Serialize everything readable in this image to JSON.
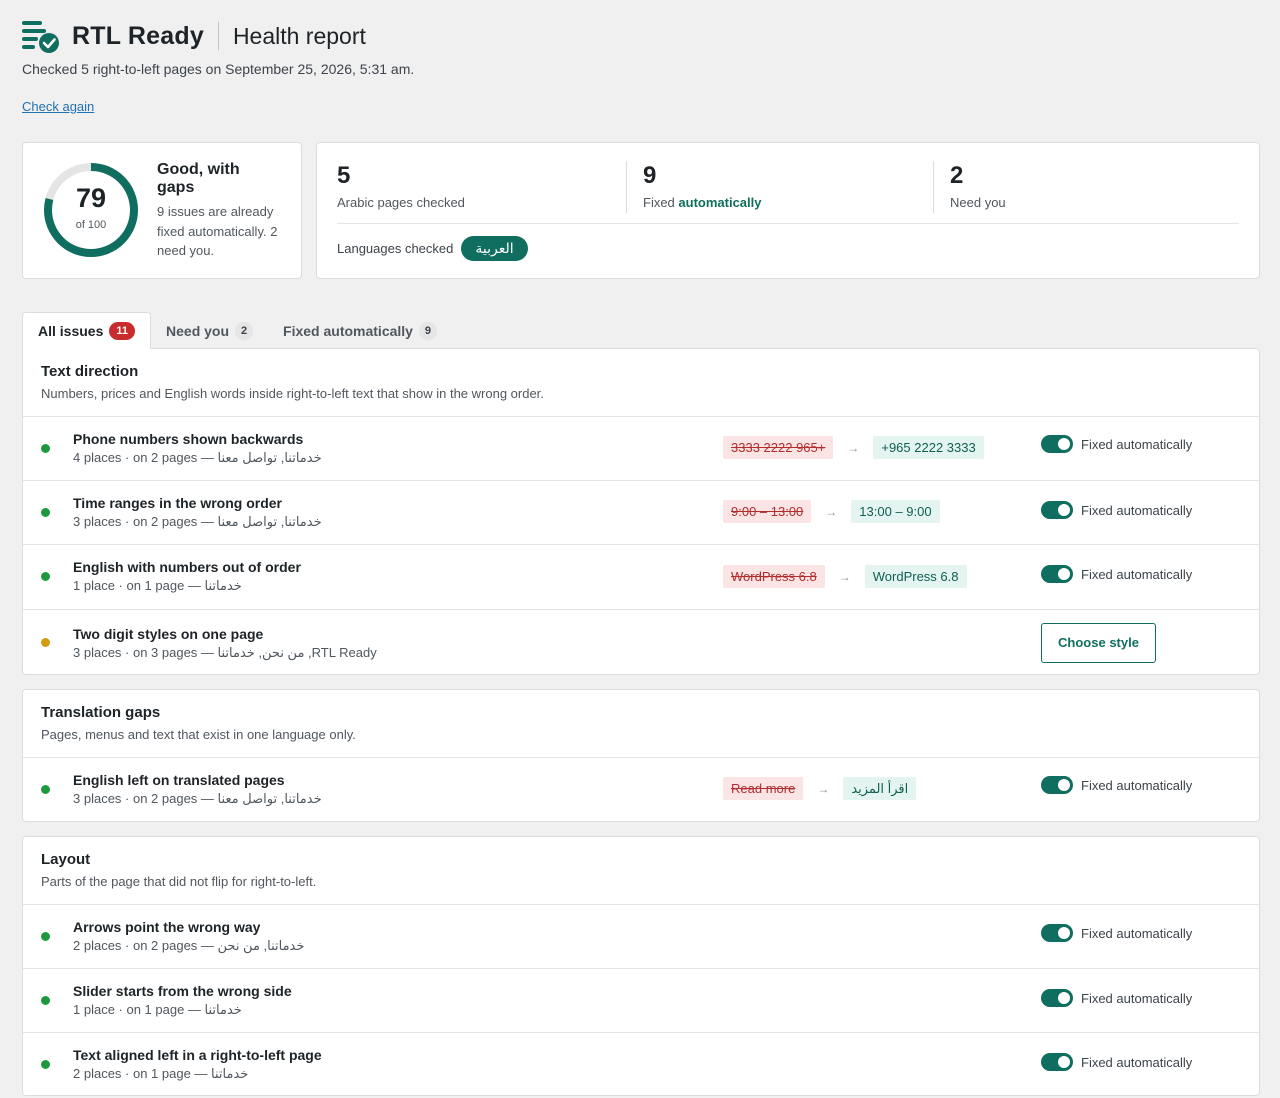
{
  "header": {
    "brand": "RTL Ready",
    "title": "Health report",
    "subtitle": "Checked 5 right-to-left pages on September 25, 2026, 5:31 am.",
    "check_again": "Check again"
  },
  "score": {
    "value": "79",
    "of": "of 100",
    "fraction": 0.79,
    "title": "Good, with gaps",
    "description": "9 issues are already fixed automatically. 2 need you."
  },
  "stats": {
    "pages": {
      "value": "5",
      "label": "Arabic pages checked"
    },
    "fixed": {
      "value": "9",
      "label_prefix": "Fixed ",
      "label_accent": "automatically"
    },
    "need": {
      "value": "2",
      "label": "Need you"
    },
    "languages_label": "Languages checked",
    "language": "العربية"
  },
  "tabs": [
    {
      "label": "All issues",
      "count": "11"
    },
    {
      "label": "Need you",
      "count": "2"
    },
    {
      "label": "Fixed automatically",
      "count": "9"
    }
  ],
  "sections": [
    {
      "title": "Text direction",
      "description": "Numbers, prices and English words inside right-to-left text that show in the wrong order.",
      "rows": [
        {
          "title": "Phone numbers shown backwards",
          "meta_prefix": "4 places · on 2 pages — ",
          "meta_pages": "خدماتنا, تواصل معنا",
          "before": "3333 2222 965+",
          "after": "+965 2222 3333",
          "status": "Fixed automatically"
        },
        {
          "title": "Time ranges in the wrong order",
          "meta_prefix": "3 places · on 2 pages — ",
          "meta_pages": "خدماتنا, تواصل معنا",
          "before": "9:00 – 13:00",
          "after": "13:00 – 9:00",
          "status": "Fixed automatically"
        },
        {
          "title": "English with numbers out of order",
          "meta_prefix": "1 place · on 1 page — ",
          "meta_pages": "خدماتنا",
          "before": "WordPress 6.8",
          "after": "WordPress 6.8",
          "status": "Fixed automatically"
        },
        {
          "title": "Two digit styles on one page",
          "meta_prefix": "3 places · on 3 pages — ",
          "meta_pages": "RTL Ready, من نحن, خدماتنا",
          "action": "Choose style"
        }
      ]
    },
    {
      "title": "Translation gaps",
      "description": "Pages, menus and text that exist in one language only.",
      "rows": [
        {
          "title": "English left on translated pages",
          "meta_prefix": "3 places · on 2 pages — ",
          "meta_pages": "خدماتنا, تواصل معنا",
          "before": "Read more",
          "after": "اقرأ المزيد",
          "status": "Fixed automatically"
        }
      ]
    },
    {
      "title": "Layout",
      "description": "Parts of the page that did not flip for right-to-left.",
      "rows": [
        {
          "title": "Arrows point the wrong way",
          "meta_prefix": "2 places · on 2 pages — ",
          "meta_pages": "خدماتنا, من نحن",
          "status": "Fixed automatically"
        },
        {
          "title": "Slider starts from the wrong side",
          "meta_prefix": "1 place · on 1 page — ",
          "meta_pages": "خدماتنا",
          "status": "Fixed automatically"
        },
        {
          "title": "Text aligned left in a right-to-left page",
          "meta_prefix": "2 places · on 1 page — ",
          "meta_pages": "خدماتنا",
          "status": "Fixed automatically"
        }
      ]
    }
  ],
  "colors": {
    "accent": "#0f6e5f",
    "ok": "#1d9a3e",
    "warn": "#d39b12",
    "alert": "#c92c2c"
  }
}
